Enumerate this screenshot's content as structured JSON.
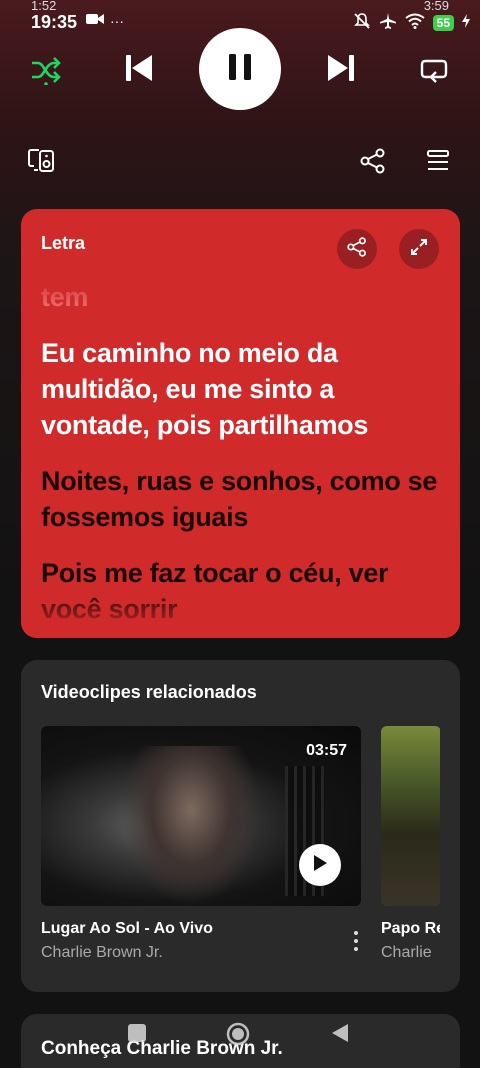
{
  "status_bar": {
    "time_small_left": "1:52",
    "time_small_right": "3:59",
    "time": "19:35",
    "more_indicator": "···",
    "battery": "55"
  },
  "player_controls": {
    "shuffle_icon": "shuffle-icon",
    "previous_icon": "skip-previous-icon",
    "pause_icon": "pause-icon",
    "next_icon": "skip-next-icon",
    "repeat_icon": "repeat-icon",
    "accent_color": "#1ed760"
  },
  "toolbar": {
    "devices_icon": "connect-device-icon",
    "share_icon": "share-icon",
    "queue_icon": "queue-icon"
  },
  "lyrics": {
    "title": "Letra",
    "card_color": "#d12a2a",
    "lines": [
      {
        "text": "tem",
        "state": "past"
      },
      {
        "text": "Eu caminho no meio da multidão, eu me sinto a vontade, pois partilhamos",
        "state": "current"
      },
      {
        "text": "Noites, ruas e sonhos, como se fossemos iguais",
        "state": "upcoming"
      },
      {
        "text": "Pois me faz tocar o céu, ver você sorrir",
        "state": "upcoming"
      }
    ]
  },
  "related_videos": {
    "title": "Videoclipes relacionados",
    "items": [
      {
        "title": "Lugar Ao Sol - Ao Vivo",
        "artist": "Charlie Brown Jr.",
        "duration": "03:57"
      },
      {
        "title": "Papo Re",
        "artist": "Charlie"
      }
    ]
  },
  "artist_section": {
    "title": "Conheça Charlie Brown Jr."
  }
}
